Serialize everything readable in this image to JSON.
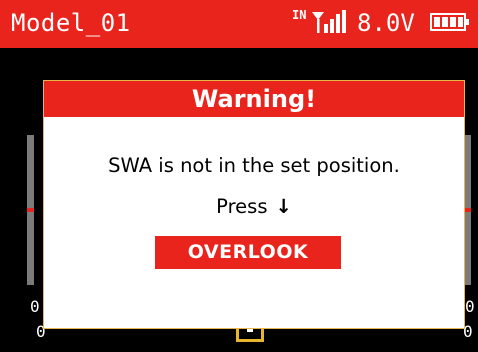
{
  "status_bar": {
    "model_name": "Model_01",
    "input_label": "IN",
    "signal_icon": "signal-strength-icon",
    "voltage": "8.0V",
    "battery_icon": "battery-icon",
    "accent_color": "#e8241c"
  },
  "background": {
    "left_bottom_label": "0",
    "left_lower_label": "0",
    "right_bottom_label": "0",
    "right_lower_label": "0"
  },
  "dialog": {
    "title": "Warning!",
    "message": "SWA is not in the set position.",
    "press_label": "Press",
    "arrow_icon": "down-arrow-icon",
    "arrow_glyph": "↓",
    "button_label": "OVERLOOK"
  }
}
